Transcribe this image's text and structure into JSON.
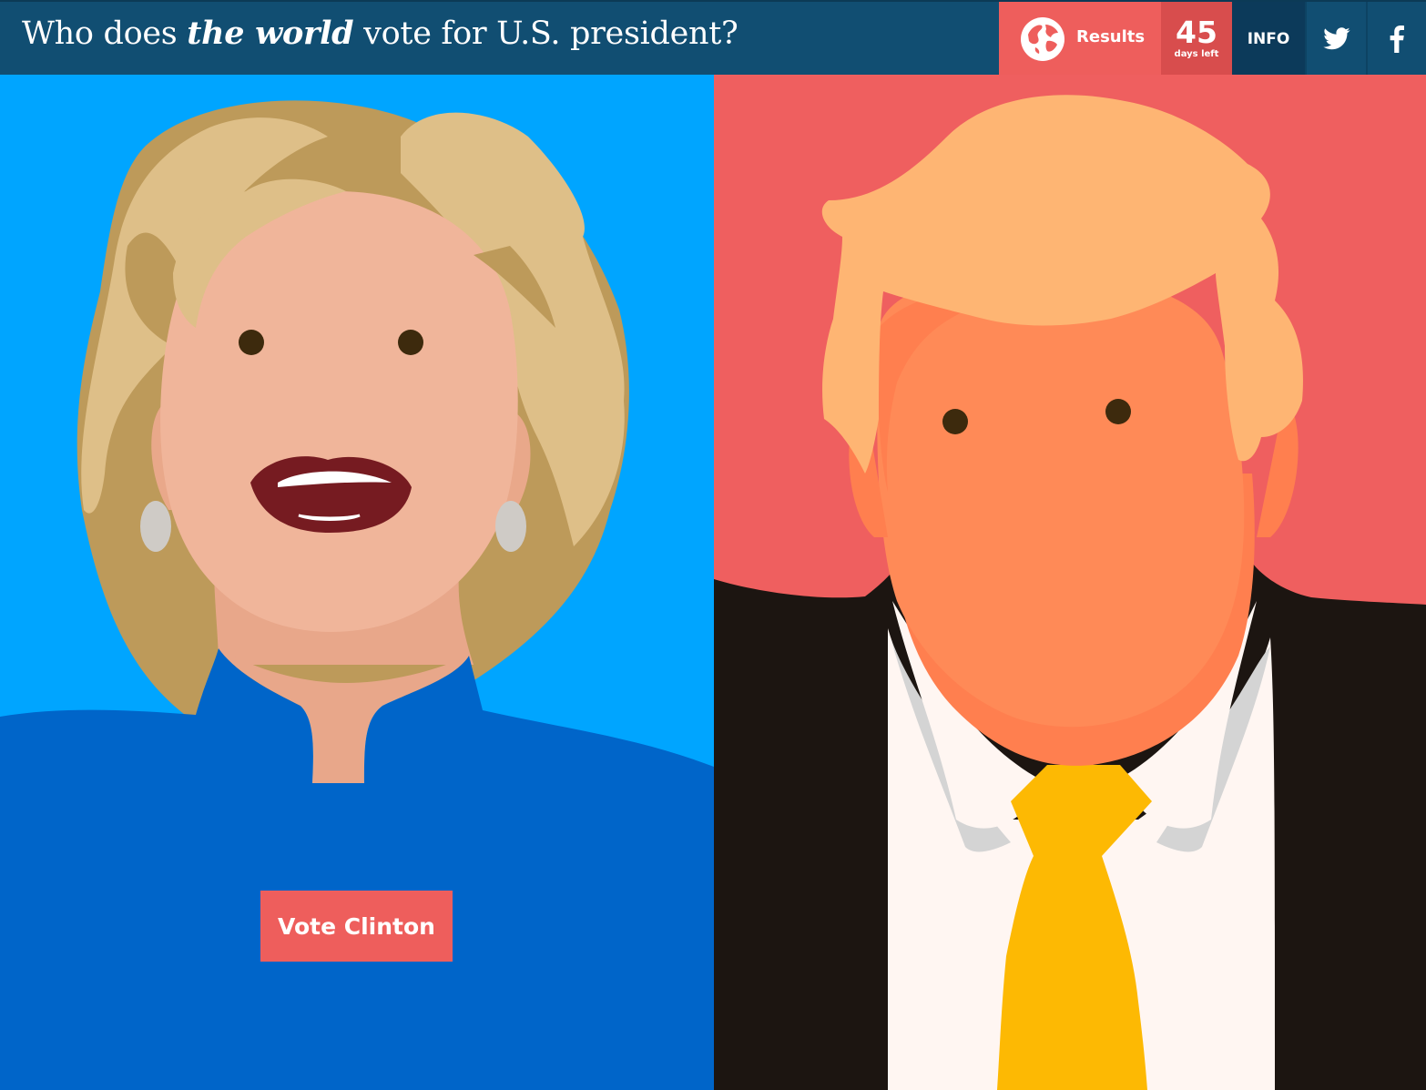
{
  "header": {
    "title_part1": "Who does ",
    "title_emphasis": "the world",
    "title_part2": " vote for U.S. president?",
    "results_label": "Results",
    "days_count": "45",
    "days_label": "days left",
    "info_label": "INFO"
  },
  "icons": {
    "results": "globe-icon",
    "twitter": "twitter-icon",
    "facebook": "facebook-icon"
  },
  "candidates": {
    "left": {
      "vote_label": "Vote Clinton"
    }
  },
  "colors": {
    "header_bg": "#114e72",
    "results_bg": "#ee5e5c",
    "days_bg": "#d84d4d",
    "info_bg": "#0c3a5a",
    "left_panel_bg": "#00a5ff",
    "right_panel_bg": "#ef5f5f",
    "vote_button_bg": "#ee5e5c"
  }
}
